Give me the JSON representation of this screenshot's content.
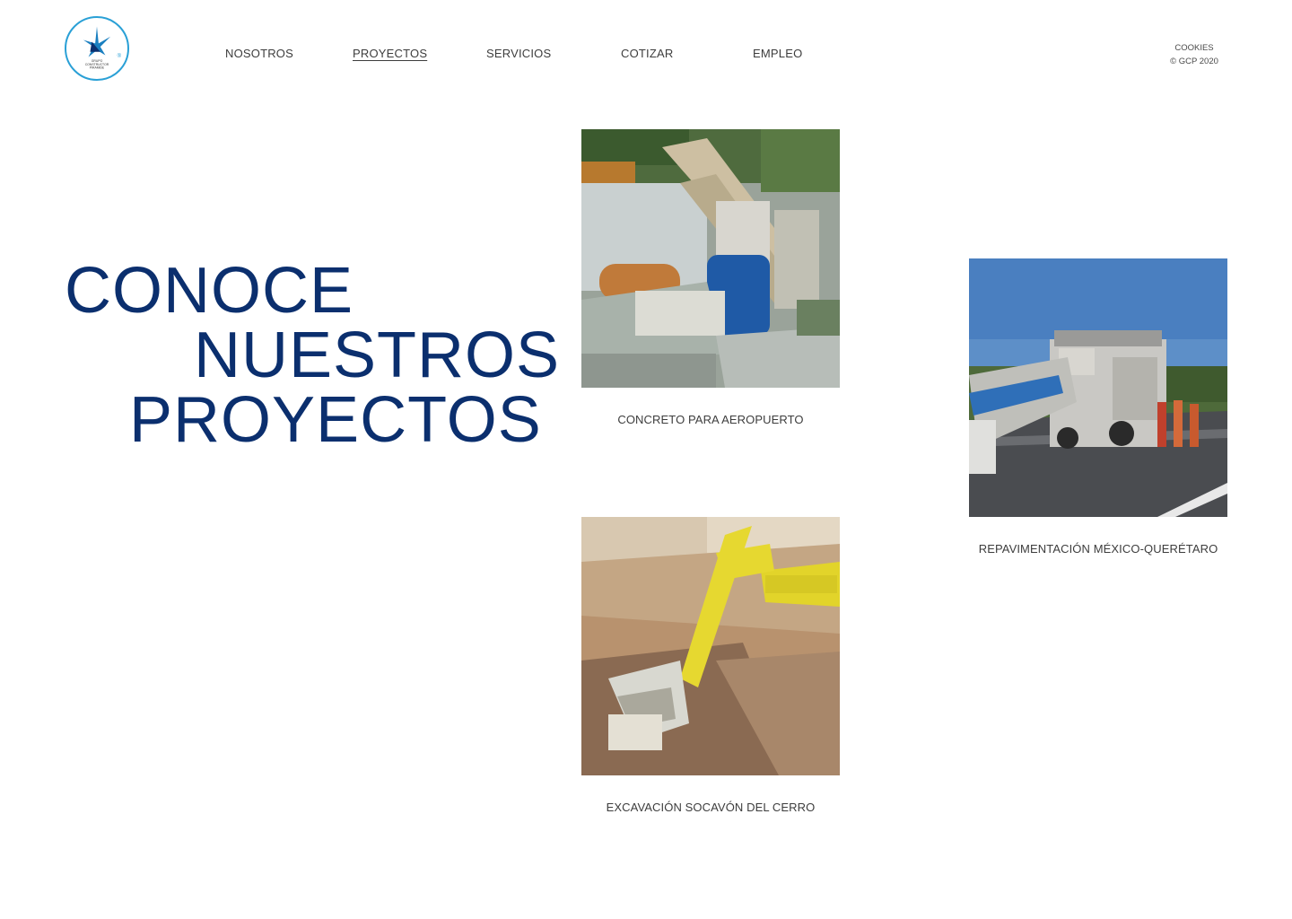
{
  "logo": {
    "name": "GRUPO CONSTRUCTOR PIRAMIDE",
    "line1": "GRUPO",
    "line2": "CONSTRUCTOR",
    "line3": "PIRAMIDE",
    "registered": "®"
  },
  "nav": {
    "items": [
      {
        "label": "NOSOTROS",
        "active": false
      },
      {
        "label": "PROYECTOS",
        "active": true
      },
      {
        "label": "SERVICIOS",
        "active": false
      },
      {
        "label": "COTIZAR",
        "active": false
      },
      {
        "label": "EMPLEO",
        "active": false
      }
    ]
  },
  "corner": {
    "cookies": "COOKIES",
    "copyright": "© GCP 2020"
  },
  "hero": {
    "line1": "CONOCE",
    "line2": "NUESTROS",
    "line3": "PROYECTOS"
  },
  "projects": [
    {
      "caption": "CONCRETO PARA AEROPUERTO",
      "image": "concrete-plant-photo"
    },
    {
      "caption": "REPAVIMENTACIÓN MÉXICO-QUERÉTARO",
      "image": "paving-machine-photo"
    },
    {
      "caption": "EXCAVACIÓN SOCAVÓN DEL CERRO",
      "image": "excavator-photo"
    }
  ],
  "colors": {
    "title": "#0b2f6e",
    "logo_ring": "#2aa0d6",
    "text": "#3d3d3d"
  }
}
